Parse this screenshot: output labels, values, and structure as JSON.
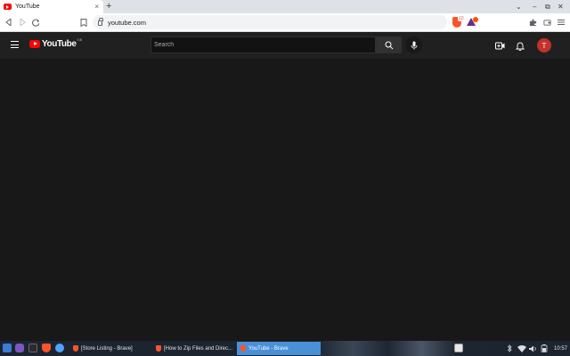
{
  "browser": {
    "tab": {
      "title": "YouTube",
      "close": "×"
    },
    "new_tab": "+",
    "window_controls": {
      "menu": "⌄",
      "minimize": "–",
      "restore": "⧉",
      "close": "✕"
    },
    "address": "youtube.com",
    "shield_count": "10"
  },
  "youtube": {
    "logo_text": "YouTube",
    "country_code": "GB",
    "search_placeholder": "Search",
    "avatar_letter": "T"
  },
  "taskbar": {
    "tasks": [
      {
        "label": "[Store Listing - Brave]",
        "active": false
      },
      {
        "label": "[How to Zip Files and Direc...",
        "active": false
      },
      {
        "label": "YouTube - Brave",
        "active": true
      }
    ],
    "clock": "10:57"
  },
  "colors": {
    "yt_red": "#ff0000",
    "brave_orange": "#fb542b",
    "yt_bg": "#181818",
    "yt_header": "#202020",
    "taskbar_active": "#4a90d9"
  }
}
